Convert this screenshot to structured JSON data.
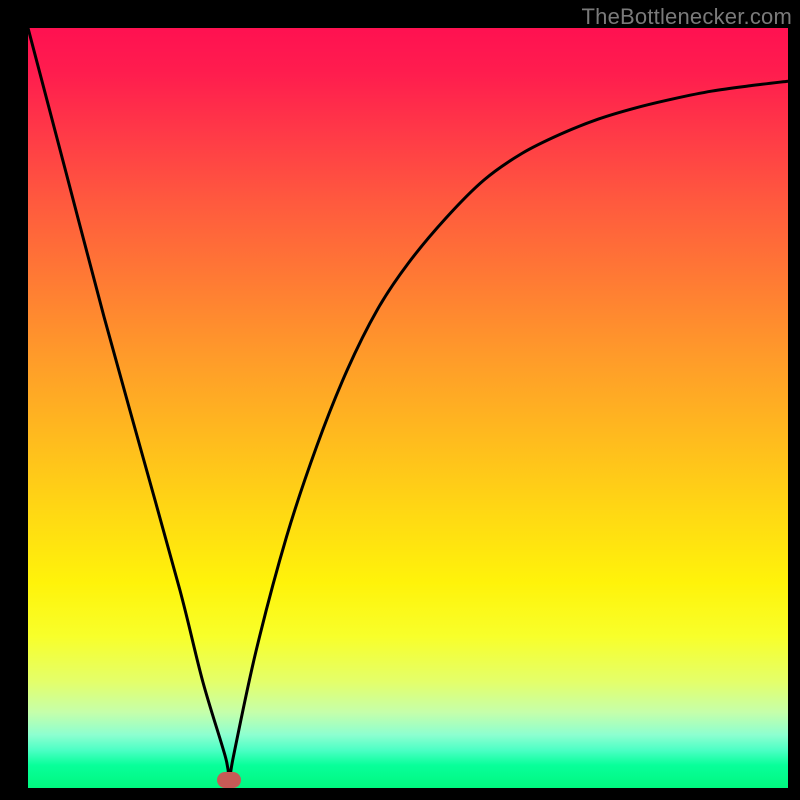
{
  "attribution": "TheBottlenecker.com",
  "chart_data": {
    "type": "line",
    "title": "",
    "xlabel": "",
    "ylabel": "",
    "xlim": [
      0,
      100
    ],
    "ylim": [
      0,
      100
    ],
    "series": [
      {
        "name": "bottleneck-curve",
        "x": [
          0,
          5,
          10,
          15,
          20,
          23,
          26,
          26.5,
          27,
          30,
          34,
          38,
          42,
          46,
          50,
          55,
          60,
          65,
          70,
          75,
          80,
          85,
          90,
          95,
          100
        ],
        "values": [
          100,
          81,
          62,
          44,
          26,
          14,
          4,
          1,
          4,
          18,
          33,
          45,
          55,
          63,
          69,
          75,
          80,
          83.5,
          86,
          88,
          89.5,
          90.7,
          91.7,
          92.4,
          93
        ]
      }
    ],
    "marker": {
      "x_pct": 26.5,
      "y_from_bottom_pct": 1.0,
      "color": "#c65a56"
    }
  },
  "colors": {
    "curve_stroke": "#000000",
    "marker": "#c65a56"
  }
}
